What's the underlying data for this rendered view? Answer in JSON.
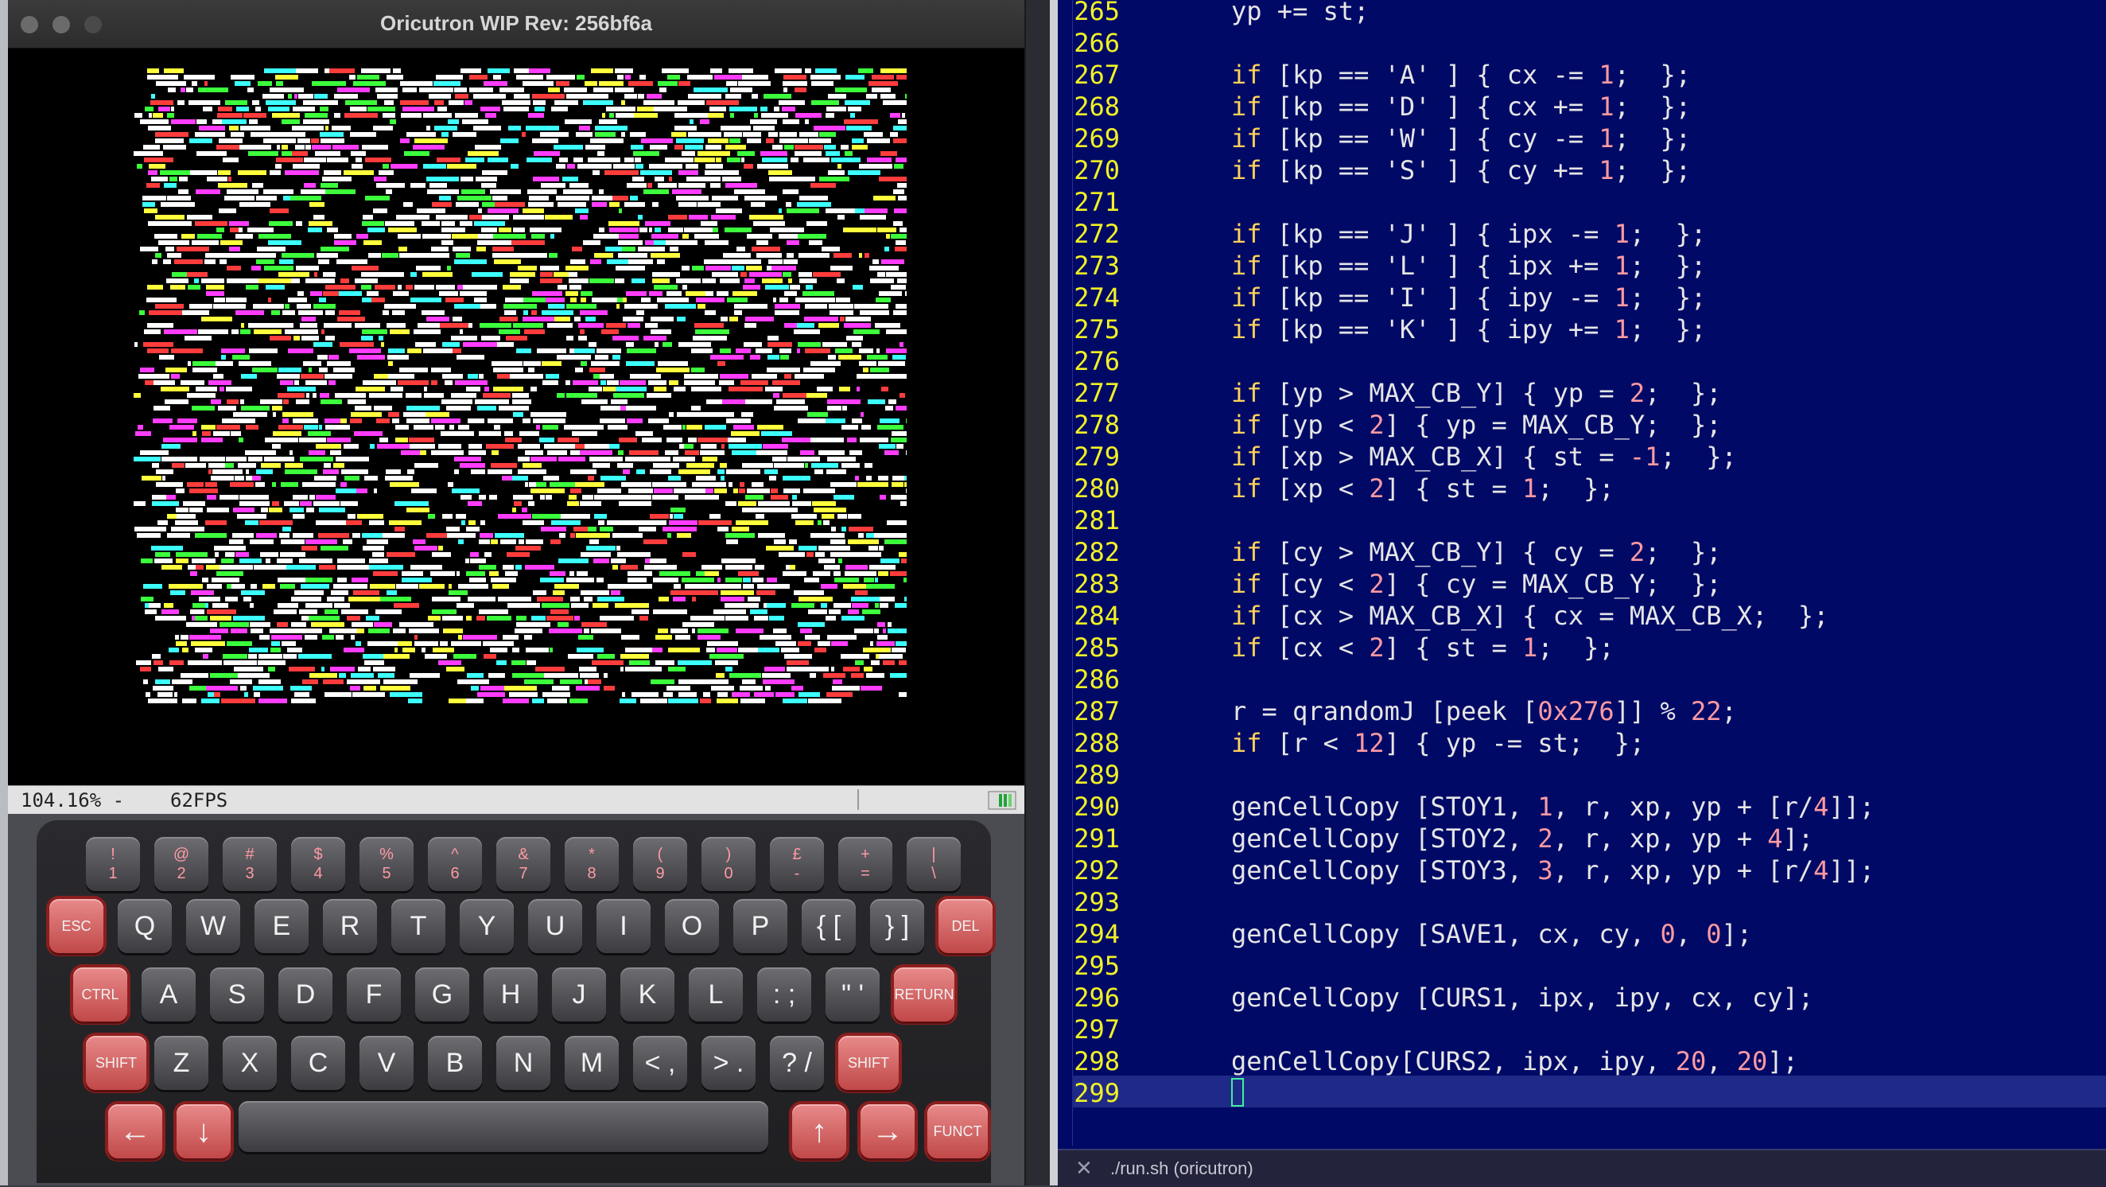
{
  "window": {
    "title": "Oricutron WIP Rev: 256bf6a",
    "status_zoom": "104.16%  -",
    "status_fps": "62FPS"
  },
  "keyboard": {
    "number_row": [
      {
        "top": "!",
        "bottom": "1"
      },
      {
        "top": "@",
        "bottom": "2"
      },
      {
        "top": "#",
        "bottom": "3"
      },
      {
        "top": "$",
        "bottom": "4"
      },
      {
        "top": "%",
        "bottom": "5"
      },
      {
        "top": "^",
        "bottom": "6"
      },
      {
        "top": "&",
        "bottom": "7"
      },
      {
        "top": "*",
        "bottom": "8"
      },
      {
        "top": "(",
        "bottom": "9"
      },
      {
        "top": ")",
        "bottom": "0"
      },
      {
        "top": "£",
        "bottom": "-"
      },
      {
        "top": "+",
        "bottom": "="
      },
      {
        "top": "|",
        "bottom": "\\"
      }
    ],
    "row_q": [
      "ESC",
      "Q",
      "W",
      "E",
      "R",
      "T",
      "Y",
      "U",
      "I",
      "O",
      "P",
      "{ [",
      "} ]",
      "DEL"
    ],
    "row_a": [
      "CTRL",
      "A",
      "S",
      "D",
      "F",
      "G",
      "H",
      "J",
      "K",
      "L",
      ": ;",
      "\" '",
      "RETURN"
    ],
    "row_z": [
      "SHIFT",
      "Z",
      "X",
      "C",
      "V",
      "B",
      "N",
      "M",
      "< ,",
      "> .",
      "? /",
      "SHIFT"
    ],
    "row_bottom": [
      "←",
      "↓",
      "↑",
      "→",
      "FUNCT"
    ]
  },
  "editor": {
    "lines": [
      {
        "n": "265",
        "code": "yp += st;"
      },
      {
        "n": "266",
        "code": ""
      },
      {
        "n": "267",
        "code": "if [kp == 'A' ] { cx -= 1;  };"
      },
      {
        "n": "268",
        "code": "if [kp == 'D' ] { cx += 1;  };"
      },
      {
        "n": "269",
        "code": "if [kp == 'W' ] { cy -= 1;  };"
      },
      {
        "n": "270",
        "code": "if [kp == 'S' ] { cy += 1;  };"
      },
      {
        "n": "271",
        "code": ""
      },
      {
        "n": "272",
        "code": "if [kp == 'J' ] { ipx -= 1;  };"
      },
      {
        "n": "273",
        "code": "if [kp == 'L' ] { ipx += 1;  };"
      },
      {
        "n": "274",
        "code": "if [kp == 'I' ] { ipy -= 1;  };"
      },
      {
        "n": "275",
        "code": "if [kp == 'K' ] { ipy += 1;  };"
      },
      {
        "n": "276",
        "code": ""
      },
      {
        "n": "277",
        "code": "if [yp > MAX_CB_Y] { yp = 2;  };"
      },
      {
        "n": "278",
        "code": "if [yp < 2] { yp = MAX_CB_Y;  };"
      },
      {
        "n": "279",
        "code": "if [xp > MAX_CB_X] { st = -1;  };"
      },
      {
        "n": "280",
        "code": "if [xp < 2] { st = 1;  };"
      },
      {
        "n": "281",
        "code": ""
      },
      {
        "n": "282",
        "code": "if [cy > MAX_CB_Y] { cy = 2;  };"
      },
      {
        "n": "283",
        "code": "if [cy < 2] { cy = MAX_CB_Y;  };"
      },
      {
        "n": "284",
        "code": "if [cx > MAX_CB_X] { cx = MAX_CB_X;  };"
      },
      {
        "n": "285",
        "code": "if [cx < 2] { st = 1;  };"
      },
      {
        "n": "286",
        "code": ""
      },
      {
        "n": "287",
        "code": "r = qrandomJ [peek [0x276]] % 22;"
      },
      {
        "n": "288",
        "code": "if [r < 12] { yp -= st;  };"
      },
      {
        "n": "289",
        "code": ""
      },
      {
        "n": "290",
        "code": "genCellCopy [STOY1, 1, r, xp, yp + [r/4]];"
      },
      {
        "n": "291",
        "code": "genCellCopy [STOY2, 2, r, xp, yp + 4];"
      },
      {
        "n": "292",
        "code": "genCellCopy [STOY3, 3, r, xp, yp + [r/4]];"
      },
      {
        "n": "293",
        "code": ""
      },
      {
        "n": "294",
        "code": "genCellCopy [SAVE1, cx, cy, 0, 0];"
      },
      {
        "n": "295",
        "code": ""
      },
      {
        "n": "296",
        "code": "genCellCopy [CURS1, ipx, ipy, cx, cy];"
      },
      {
        "n": "297",
        "code": ""
      },
      {
        "n": "298",
        "code": "genCellCopy[CURS2, ipx, ipy, 20, 20];"
      },
      {
        "n": "299",
        "code": ""
      }
    ],
    "tab_label": "./run.sh (oricutron)",
    "colors": {
      "background": "#000a66",
      "line_numbers": "#f2f224",
      "keyword": "#ffd25a",
      "number": "#ff9aa2"
    }
  }
}
